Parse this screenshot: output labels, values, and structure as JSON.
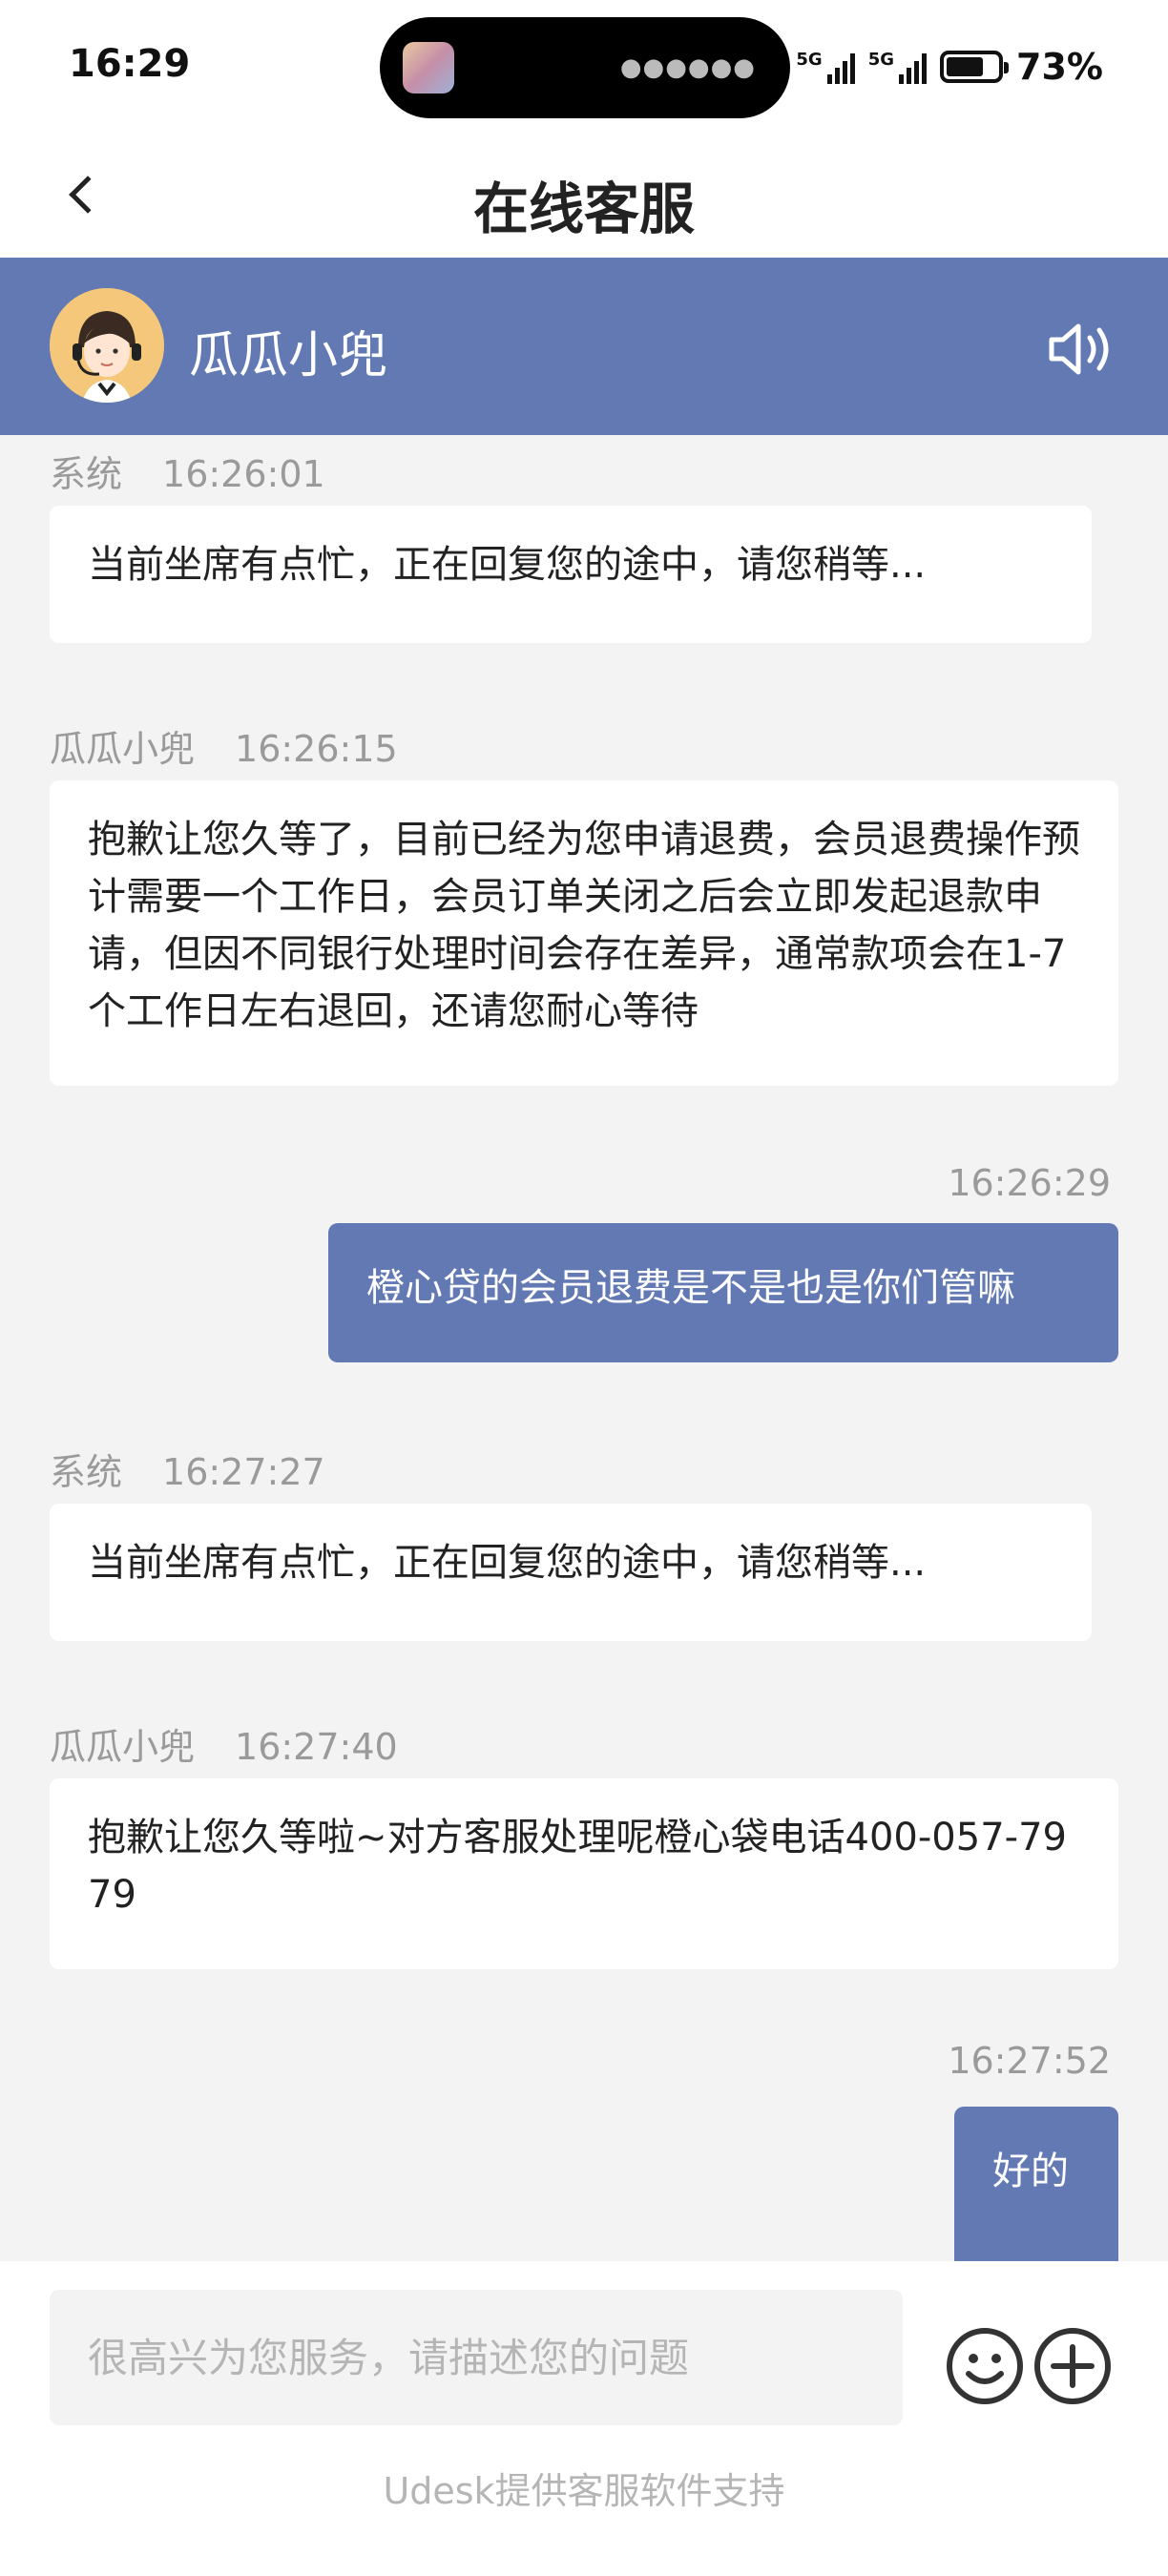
{
  "status_bar": {
    "time": "16:29",
    "network1": "5G",
    "network2": "5G",
    "battery": "73%",
    "battery_level": 0.73
  },
  "header": {
    "title": "在线客服"
  },
  "agent": {
    "name": "瓜瓜小兜"
  },
  "messages": [
    {
      "sender": "系统",
      "time": "16:26:01",
      "text": "当前坐席有点忙，正在回复您的途中，请您稍等...",
      "side": "left"
    },
    {
      "sender": "瓜瓜小兜",
      "time": "16:26:15",
      "text": "抱歉让您久等了，目前已经为您申请退费，会员退费操作预计需要一个工作日，会员订单关闭之后会立即发起退款申请，但因不同银行处理时间会存在差异，通常款项会在1-7 个工作日左右退回，还请您耐心等待",
      "side": "left"
    },
    {
      "time": "16:26:29",
      "text": "橙心贷的会员退费是不是也是你们管嘛",
      "side": "right"
    },
    {
      "sender": "系统",
      "time": "16:27:27",
      "text": "当前坐席有点忙，正在回复您的途中，请您稍等...",
      "side": "left"
    },
    {
      "sender": "瓜瓜小兜",
      "time": "16:27:40",
      "text": "抱歉让您久等啦~对方客服处理呢橙心袋电话400-057-7979",
      "side": "left"
    },
    {
      "time": "16:27:52",
      "text": "好的",
      "side": "right"
    }
  ],
  "composer": {
    "placeholder": "很高兴为您服务，请描述您的问题"
  },
  "footer": {
    "powered_by": "Udesk提供客服软件支持"
  },
  "colors": {
    "accent": "#6279b3",
    "background": "#f3f3f3"
  },
  "icons": {
    "back": "back-arrow-icon",
    "speaker": "speaker-icon",
    "emoji": "emoji-icon",
    "add": "plus-circle-icon"
  }
}
